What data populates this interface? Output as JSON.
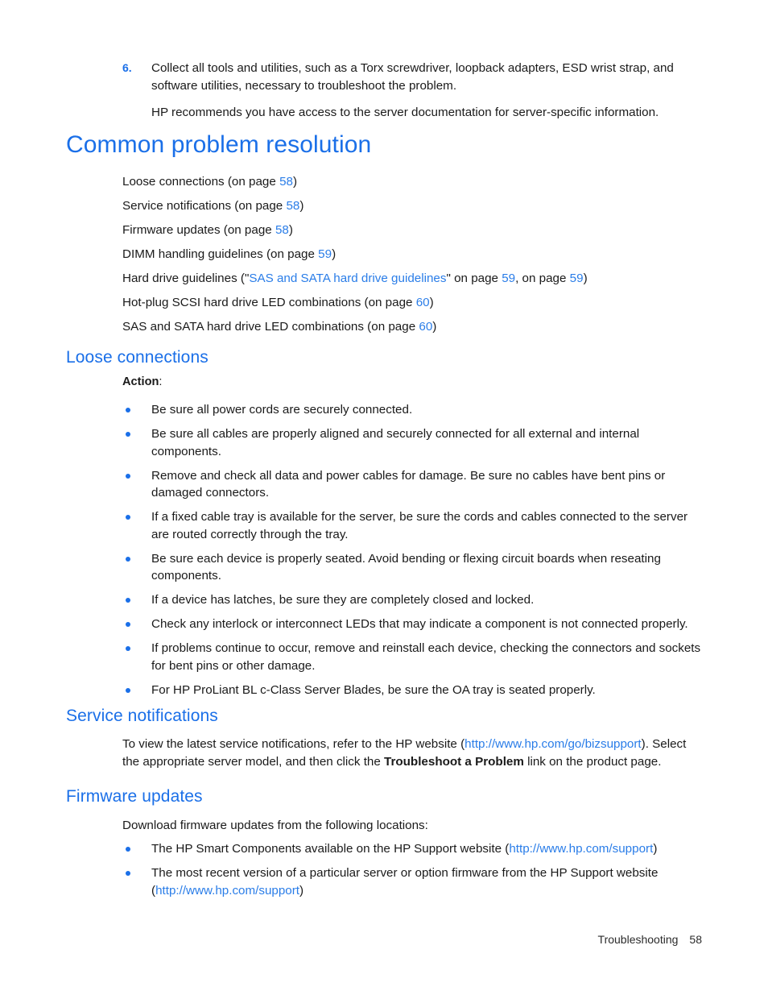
{
  "step": {
    "number": "6.",
    "text": "Collect all tools and utilities, such as a Torx screwdriver, loopback adapters, ESD wrist strap, and software utilities, necessary to troubleshoot the problem.",
    "follow_up": "HP recommends you have access to the server documentation for server-specific information."
  },
  "headings": {
    "h1": "Common problem resolution",
    "loose_connections": "Loose connections",
    "service_notifications": "Service notifications",
    "firmware_updates": "Firmware updates"
  },
  "toc": [
    {
      "text": "Loose connections (on page ",
      "page": "58",
      "tail": ")"
    },
    {
      "text": "Service notifications (on page ",
      "page": "58",
      "tail": ")"
    },
    {
      "text": "Firmware updates (on page ",
      "page": "58",
      "tail": ")"
    },
    {
      "text": "DIMM handling guidelines (on page ",
      "page": "59",
      "tail": ")"
    }
  ],
  "toc_hard_drive": {
    "lead": "Hard drive guidelines (\"",
    "link": "SAS and SATA hard drive guidelines",
    "mid": "\" on page ",
    "page1": "59",
    "mid2": ", on page ",
    "page2": "59",
    "tail": ")"
  },
  "toc_tail": [
    {
      "text": "Hot-plug SCSI hard drive LED combinations (on page ",
      "page": "60",
      "tail": ")"
    },
    {
      "text": "SAS and SATA hard drive LED combinations (on page ",
      "page": "60",
      "tail": ")"
    }
  ],
  "action": {
    "label": "Action",
    "colon": ":"
  },
  "loose_bullets": [
    "Be sure all power cords are securely connected.",
    "Be sure all cables are properly aligned and securely connected for all external and internal components.",
    "Remove and check all data and power cables for damage. Be sure no cables have bent pins or damaged connectors.",
    "If a fixed cable tray is available for the server, be sure the cords and cables connected to the server are routed correctly through the tray.",
    "Be sure each device is properly seated. Avoid bending or flexing circuit boards when reseating components.",
    "If a device has latches, be sure they are completely closed and locked.",
    "Check any interlock or interconnect LEDs that may indicate a component is not connected properly.",
    "If problems continue to occur, remove and reinstall each device, checking the connectors and sockets for bent pins or other damage.",
    "For HP ProLiant BL c-Class Server Blades, be sure the OA tray is seated properly."
  ],
  "service_paragraph": {
    "part1": "To view the latest service notifications, refer to the HP website (",
    "url": "http://www.hp.com/go/bizsupport",
    "part2": "). Select the appropriate server model, and then click the ",
    "bold": "Troubleshoot a Problem",
    "part3": " link on the product page."
  },
  "firmware_intro": "Download firmware updates from the following locations:",
  "firmware_bullets": [
    {
      "part1": "The HP Smart Components available on the HP Support website (",
      "url": "http://www.hp.com/support",
      "part2": ")"
    },
    {
      "part1": "The most recent version of a particular server or option firmware from the HP Support website (",
      "url": "http://www.hp.com/support",
      "part2": ")"
    }
  ],
  "footer": {
    "section": "Troubleshooting",
    "page_number": "58"
  },
  "colors": {
    "heading_blue": "#1a6fe8",
    "link_blue": "#2a7de8",
    "body_text": "#1a1a1a"
  }
}
